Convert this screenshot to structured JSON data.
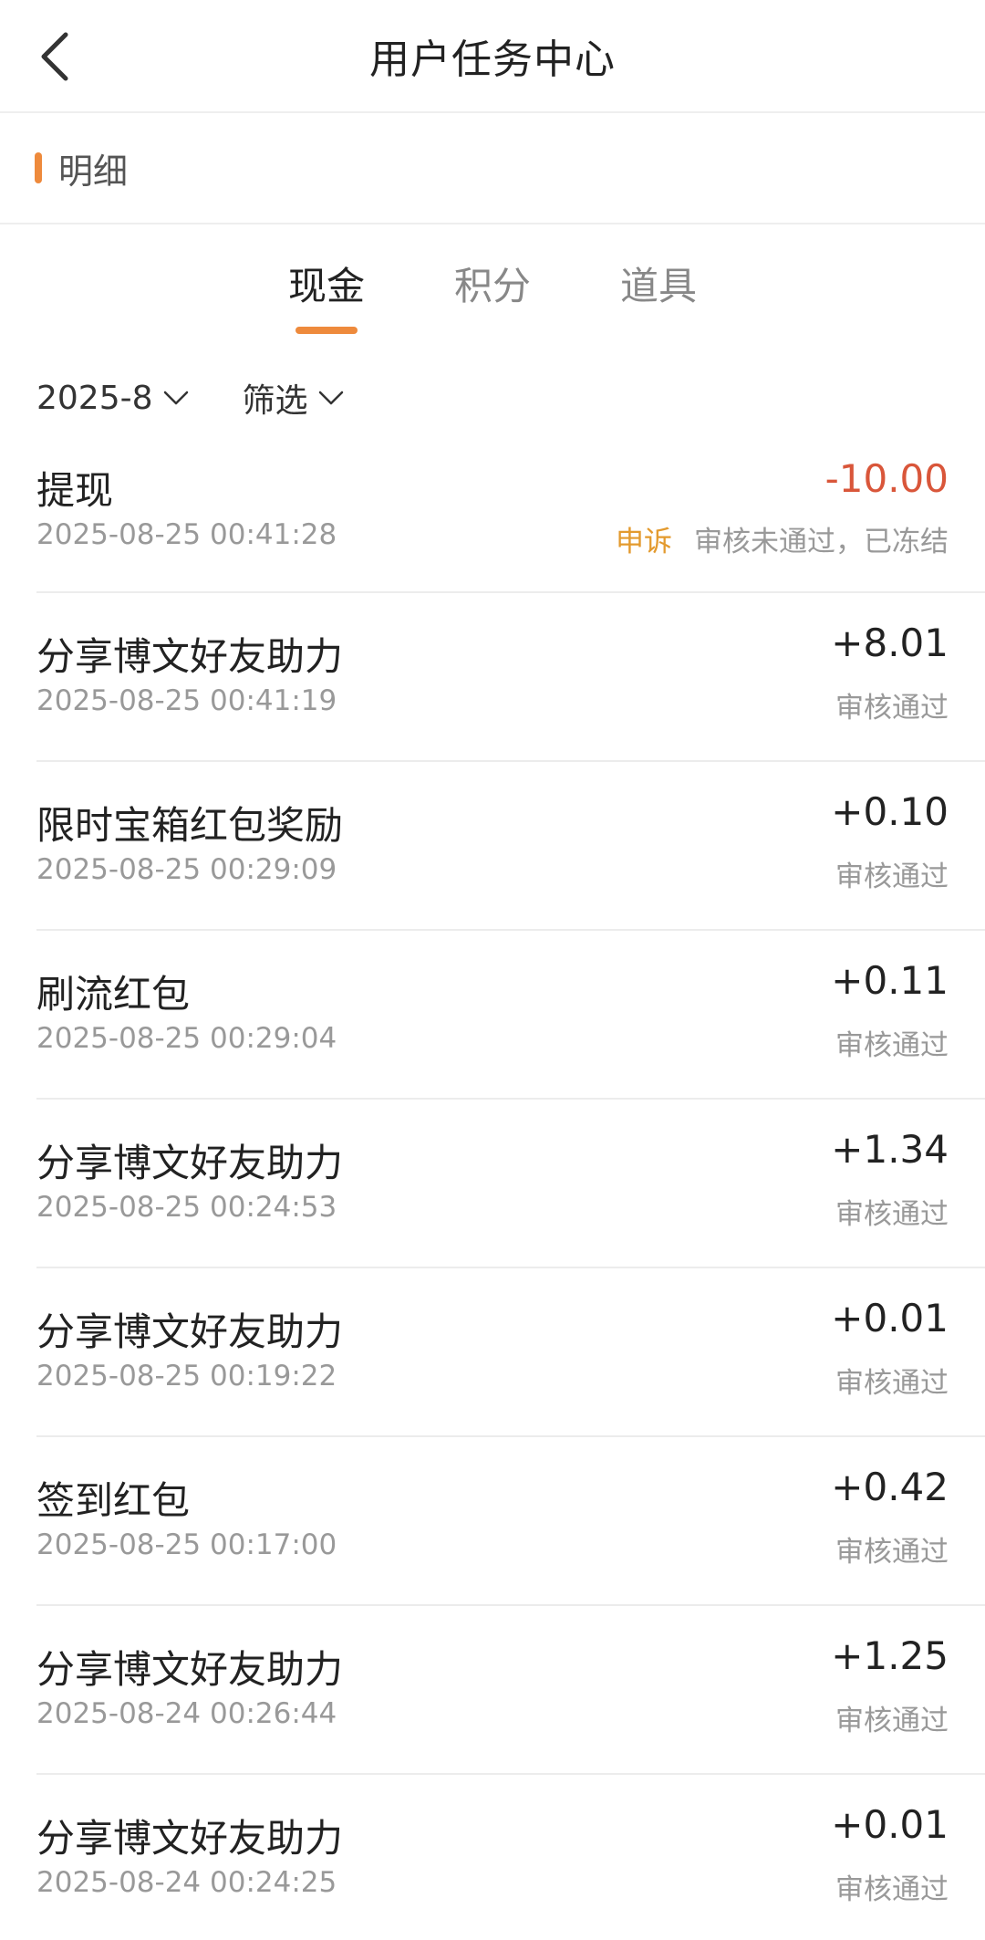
{
  "header": {
    "title": "用户任务中心"
  },
  "section": {
    "label": "明细"
  },
  "tabs": [
    {
      "label": "现金",
      "active": true
    },
    {
      "label": "积分",
      "active": false
    },
    {
      "label": "道具",
      "active": false
    }
  ],
  "filters": {
    "month": "2025-8",
    "filter": "筛选"
  },
  "colors": {
    "accent": "#ee8a3c",
    "negative": "#d9563a",
    "appeal": "#e39a2e"
  },
  "records": [
    {
      "title": "提现",
      "time": "2025-08-25 00:41:28",
      "amount": "-10.00",
      "status": "审核未通过，已冻结",
      "appeal": "申诉"
    },
    {
      "title": "分享博文好友助力",
      "time": "2025-08-25 00:41:19",
      "amount": "+8.01",
      "status": "审核通过"
    },
    {
      "title": "限时宝箱红包奖励",
      "time": "2025-08-25 00:29:09",
      "amount": "+0.10",
      "status": "审核通过"
    },
    {
      "title": "刷流红包",
      "time": "2025-08-25 00:29:04",
      "amount": "+0.11",
      "status": "审核通过"
    },
    {
      "title": "分享博文好友助力",
      "time": "2025-08-25 00:24:53",
      "amount": "+1.34",
      "status": "审核通过"
    },
    {
      "title": "分享博文好友助力",
      "time": "2025-08-25 00:19:22",
      "amount": "+0.01",
      "status": "审核通过"
    },
    {
      "title": "签到红包",
      "time": "2025-08-25 00:17:00",
      "amount": "+0.42",
      "status": "审核通过"
    },
    {
      "title": "分享博文好友助力",
      "time": "2025-08-24 00:26:44",
      "amount": "+1.25",
      "status": "审核通过"
    },
    {
      "title": "分享博文好友助力",
      "time": "2025-08-24 00:24:25",
      "amount": "+0.01",
      "status": "审核通过"
    }
  ]
}
